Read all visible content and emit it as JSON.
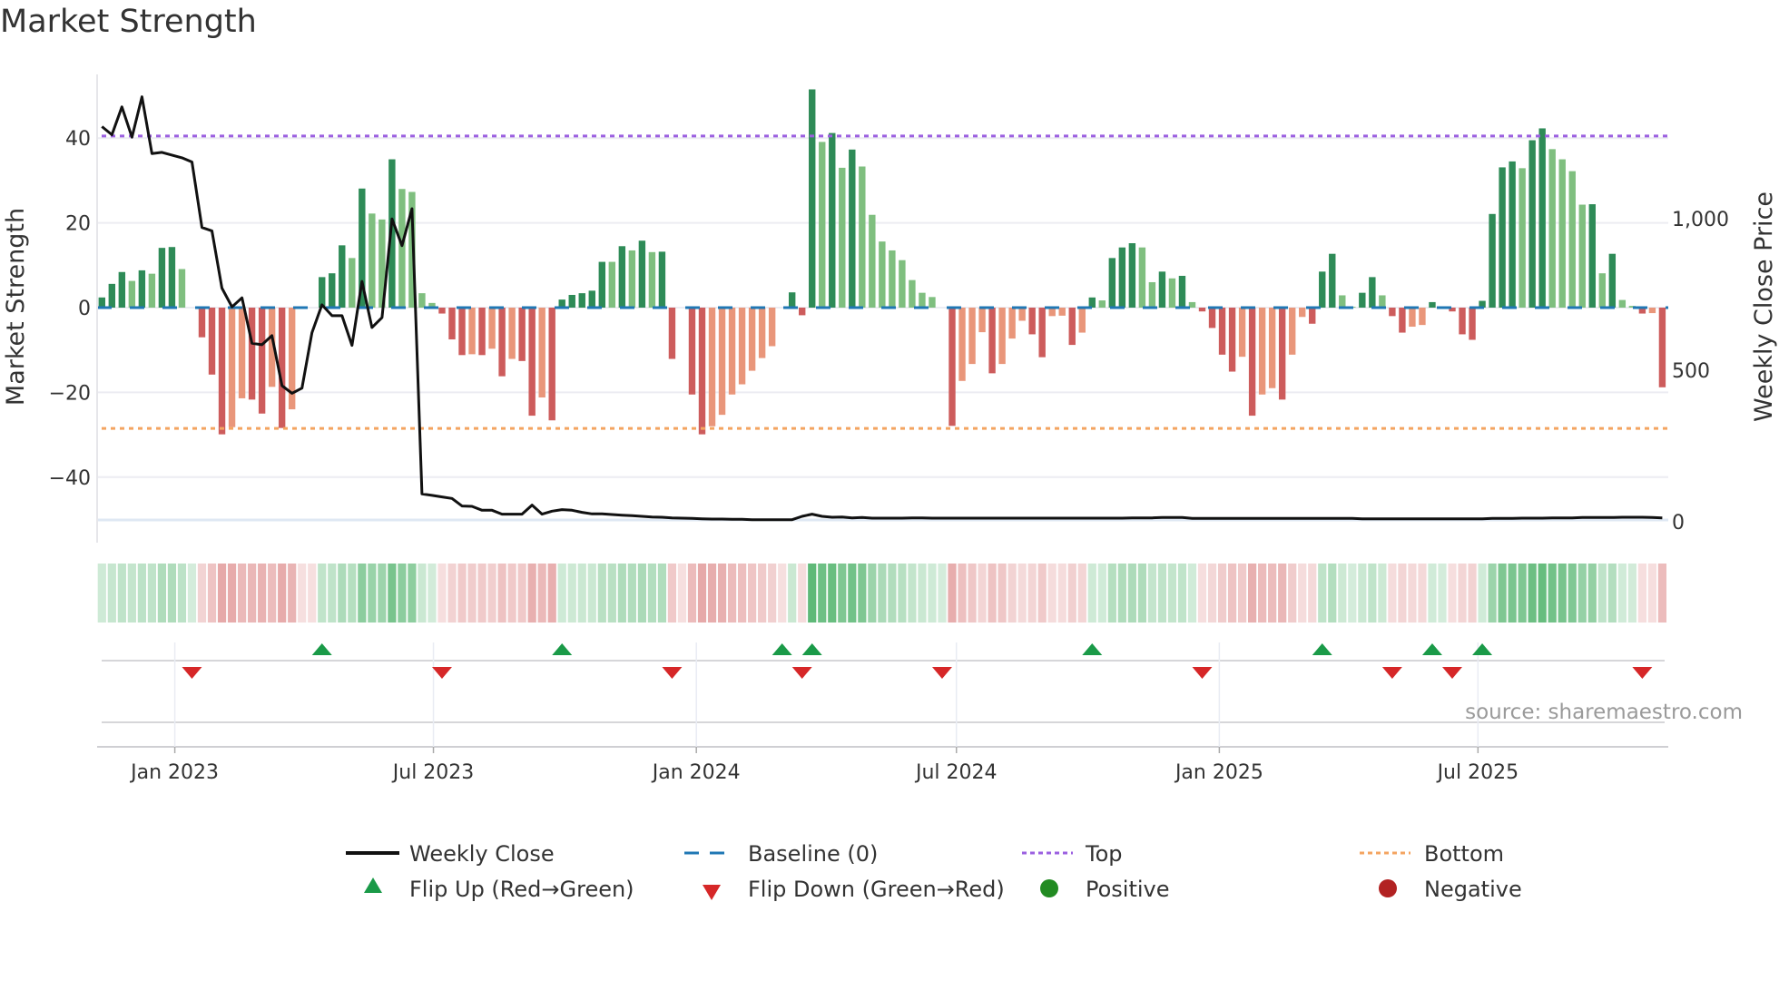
{
  "title": "Market Strength",
  "source": "source: sharemaestro.com",
  "colors": {
    "pos_strong": "#2e8b57",
    "pos_weak": "#7fbf7f",
    "neg_strong": "#cd5c5c",
    "neg_weak": "#e9967a",
    "top": "#9b5fe0",
    "bottom": "#f4a460",
    "baseline": "#1f77b4",
    "close": "#111111",
    "flip_up": "#1a9a48",
    "flip_down": "#d62728",
    "positive": "#228b22",
    "negative": "#b22222"
  },
  "chart_data": {
    "type": "bar",
    "title": "Market Strength",
    "ylabel": "Market Strength",
    "y2label": "Weekly Close Price",
    "ylim": [
      -52,
      55
    ],
    "y_ticks": [
      40,
      20,
      0,
      -20,
      -40
    ],
    "y_tick_labels": [
      "40",
      "20",
      "0",
      "−20",
      "−40"
    ],
    "y2lim": [
      0,
      1530
    ],
    "y2_ticks": [
      1000,
      500,
      0
    ],
    "y2_tick_labels": [
      "1,000",
      "500",
      "0"
    ],
    "x_start": "2022-11-11",
    "x_interval": "weekly",
    "x_ticks": [
      "2023-01-01",
      "2023-07-01",
      "2024-01-01",
      "2024-07-01",
      "2025-01-01",
      "2025-07-01"
    ],
    "x_tick_labels": [
      "Jan 2023",
      "Jul 2023",
      "Jan 2024",
      "Jul 2024",
      "Jan 2025",
      "Jul 2025"
    ],
    "top_level": 40.5,
    "bottom_level": -28.5,
    "baseline": 0,
    "strength": [
      2.4,
      5.6,
      8.4,
      6.3,
      8.8,
      8.0,
      14.1,
      14.3,
      9.1,
      0,
      -7.0,
      -15.8,
      -29.9,
      -28.2,
      -21.4,
      -21.7,
      -25,
      -18.7,
      -28.4,
      -24,
      0,
      0,
      7.2,
      8.1,
      14.7,
      11.7,
      28.1,
      22.2,
      20.8,
      35,
      28,
      27.3,
      3.4,
      1.1,
      -1.4,
      -7.5,
      -11.2,
      -11,
      -11.2,
      -9.7,
      -16.2,
      -12.1,
      -12.6,
      -25.5,
      -21.2,
      -26.6,
      1.9,
      3.0,
      3.4,
      4.0,
      10.8,
      10.8,
      14.5,
      13.5,
      15.8,
      13.1,
      13.2,
      -12.1,
      0,
      -20.5,
      -29.9,
      -28,
      -25.3,
      -20.5,
      -18.1,
      -14.9,
      -11.9,
      -9.1,
      0,
      3.6,
      -1.8,
      51.5,
      39.1,
      41.2,
      33,
      37.3,
      33.3,
      21.9,
      15.6,
      13.5,
      11.2,
      6.5,
      3.5,
      2.5,
      0,
      -27.9,
      -17.3,
      -13.3,
      -5.8,
      -15.5,
      -13.3,
      -7.3,
      -3.1,
      -6.3,
      -11.7,
      -2,
      -1.9,
      -8.8,
      -5.9,
      2.4,
      1.7,
      11.7,
      14.2,
      15.2,
      14.2,
      6,
      8.5,
      6.9,
      7.5,
      1.3,
      -0.9,
      -4.8,
      -11.1,
      -15.1,
      -11.6,
      -25.5,
      -20.5,
      -19,
      -21.7,
      -11.1,
      -2.2,
      -3.8,
      8.5,
      12.7,
      2.9,
      0.2,
      3.5,
      7.2,
      2.9,
      -2,
      -5.9,
      -4.5,
      -4.1,
      1.3,
      0,
      -0.9,
      -6.3,
      -7.6,
      1.6,
      22.1,
      33.1,
      34.5,
      32.9,
      39.5,
      42.3,
      37.4,
      35,
      32.2,
      24.3,
      24.4,
      8.1,
      12.7,
      1.8,
      0.4,
      -1.4,
      -1.3,
      -18.8
    ],
    "strong": [
      1,
      1,
      1,
      0,
      1,
      0,
      1,
      1,
      0,
      0,
      1,
      1,
      1,
      0,
      0,
      1,
      1,
      0,
      1,
      0,
      0,
      0,
      1,
      1,
      1,
      0,
      1,
      0,
      0,
      1,
      0,
      0,
      0,
      0,
      1,
      1,
      1,
      0,
      1,
      0,
      1,
      0,
      1,
      1,
      0,
      1,
      1,
      1,
      1,
      1,
      1,
      0,
      1,
      0,
      1,
      0,
      1,
      1,
      0,
      1,
      1,
      0,
      0,
      0,
      0,
      0,
      0,
      0,
      0,
      1,
      1,
      1,
      0,
      1,
      0,
      1,
      0,
      0,
      0,
      0,
      0,
      0,
      0,
      0,
      0,
      1,
      0,
      0,
      0,
      1,
      0,
      0,
      0,
      1,
      1,
      0,
      0,
      1,
      0,
      1,
      0,
      1,
      1,
      1,
      0,
      0,
      1,
      0,
      1,
      0,
      1,
      1,
      1,
      1,
      0,
      1,
      0,
      0,
      1,
      0,
      0,
      1,
      1,
      1,
      0,
      0,
      1,
      1,
      0,
      1,
      1,
      0,
      0,
      1,
      0,
      1,
      1,
      1,
      1,
      1,
      1,
      1,
      0,
      1,
      1,
      0,
      0,
      0,
      0,
      1,
      0,
      1,
      0,
      0,
      1,
      0,
      1
    ],
    "weekly_close": [
      1304,
      1277,
      1369,
      1269,
      1402,
      1215,
      1219,
      1210,
      1201,
      1187,
      971,
      960,
      771,
      709,
      739,
      589,
      584,
      614,
      449,
      424,
      441,
      624,
      716,
      680,
      680,
      582,
      793,
      641,
      674,
      999,
      911,
      1033,
      92,
      87,
      82,
      77,
      52,
      51,
      38,
      38,
      25,
      25,
      25,
      55,
      25,
      35,
      40,
      38,
      31,
      26,
      26,
      24,
      22,
      20,
      18,
      16,
      15,
      13,
      12,
      11,
      10,
      9,
      9,
      8,
      8,
      7,
      7,
      7,
      7,
      7,
      18,
      25,
      18,
      15,
      16,
      13,
      14,
      12,
      12,
      12,
      12,
      13,
      13,
      12,
      12,
      12,
      12,
      12,
      12,
      12,
      12,
      12,
      12,
      12,
      12,
      12,
      12,
      12,
      12,
      12,
      12,
      12,
      12,
      13,
      13,
      13,
      14,
      14,
      14,
      11,
      11,
      11,
      11,
      11,
      11,
      11,
      11,
      11,
      11,
      11,
      11,
      11,
      11,
      11,
      11,
      11,
      10,
      10,
      10,
      10,
      10,
      10,
      10,
      10,
      10,
      10,
      10,
      10,
      10,
      11,
      11,
      11,
      12,
      12,
      12,
      13,
      13,
      13,
      14,
      14,
      14,
      14,
      15,
      15,
      15,
      14,
      13
    ],
    "flip_up_weeks": [
      22,
      46,
      68,
      71,
      99,
      122,
      133,
      138
    ],
    "flip_down_weeks": [
      9,
      34,
      57,
      70,
      84,
      110,
      129,
      135,
      154
    ],
    "legend_placement": "bottom"
  },
  "legend": {
    "weekly_close": "Weekly Close",
    "baseline": "Baseline (0)",
    "top": "Top",
    "bottom": "Bottom",
    "flip_up": "Flip Up (Red→Green)",
    "flip_down": "Flip Down (Green→Red)",
    "positive": "Positive",
    "negative": "Negative"
  }
}
